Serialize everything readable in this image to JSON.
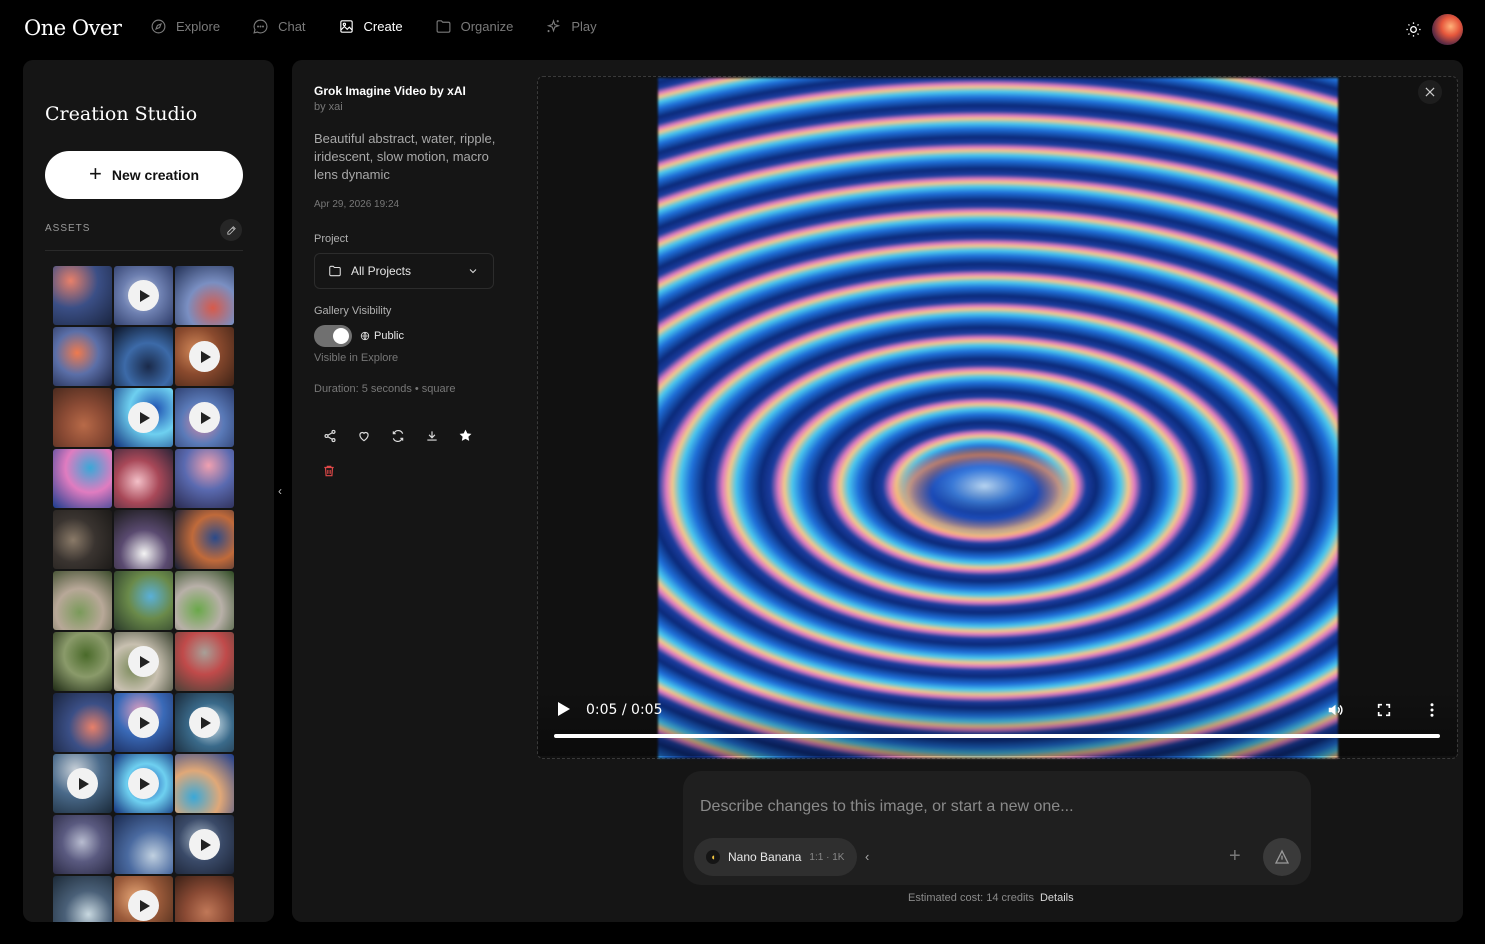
{
  "app": {
    "logo": "One Over"
  },
  "nav": [
    {
      "label": "Explore",
      "icon": "compass-icon",
      "active": false
    },
    {
      "label": "Chat",
      "icon": "chat-bubble-icon",
      "active": false
    },
    {
      "label": "Create",
      "icon": "image-icon",
      "active": true
    },
    {
      "label": "Organize",
      "icon": "folder-icon",
      "active": false
    },
    {
      "label": "Play",
      "icon": "sparkles-icon",
      "active": false
    }
  ],
  "sidebar": {
    "title": "Creation Studio",
    "new_button": "New creation",
    "assets_label": "ASSETS",
    "thumbnails": [
      {
        "video": false,
        "colors": [
          "#e8806a",
          "#3b4f86",
          "#1a2540"
        ]
      },
      {
        "video": true,
        "colors": [
          "#c9d2e8",
          "#6d7fb0",
          "#2d3b68"
        ]
      },
      {
        "video": false,
        "colors": [
          "#d85a4a",
          "#7a8fc2",
          "#223055"
        ]
      },
      {
        "video": false,
        "colors": [
          "#ef7a4e",
          "#5b6fa8",
          "#1c2546"
        ]
      },
      {
        "video": false,
        "colors": [
          "#1a2a4a",
          "#3c6aa8",
          "#0c1426"
        ]
      },
      {
        "video": true,
        "colors": [
          "#d48a5a",
          "#8a4a2e",
          "#3e2216"
        ]
      },
      {
        "video": false,
        "colors": [
          "#b86a48",
          "#8a4a34",
          "#4a2a1e"
        ]
      },
      {
        "video": true,
        "colors": [
          "#1e4fb0",
          "#6ed0f0",
          "#12307a"
        ]
      },
      {
        "video": true,
        "colors": [
          "#d28aa8",
          "#5a7ab8",
          "#2a3a6a"
        ]
      },
      {
        "video": false,
        "colors": [
          "#3aa8d8",
          "#e07cc0",
          "#1a3c8e"
        ]
      },
      {
        "video": false,
        "colors": [
          "#f3c0c8",
          "#a84858",
          "#2a2438"
        ]
      },
      {
        "video": false,
        "colors": [
          "#f0a0b0",
          "#5a6ab0",
          "#2a2a50"
        ]
      },
      {
        "video": false,
        "colors": [
          "#8a7a68",
          "#3a3430",
          "#1c1a18"
        ]
      },
      {
        "video": false,
        "colors": [
          "#f4f4f4",
          "#5a4a70",
          "#1a1a1a"
        ]
      },
      {
        "video": false,
        "colors": [
          "#2a4a8a",
          "#c06a3a",
          "#151e36"
        ]
      },
      {
        "video": false,
        "colors": [
          "#7a9a5a",
          "#b8a898",
          "#3a4a2a"
        ]
      },
      {
        "video": false,
        "colors": [
          "#5ab0d8",
          "#6a8a4a",
          "#2a3a2a"
        ]
      },
      {
        "video": false,
        "colors": [
          "#6aa84a",
          "#b8b0a8",
          "#2e4a22"
        ]
      },
      {
        "video": false,
        "colors": [
          "#4a6a2a",
          "#8a9a6a",
          "#1e2a14"
        ]
      },
      {
        "video": true,
        "colors": [
          "#7a8a5a",
          "#c8c0b0",
          "#3a4230"
        ]
      },
      {
        "video": false,
        "colors": [
          "#a8a098",
          "#c04a4a",
          "#4a4238"
        ]
      },
      {
        "video": false,
        "colors": [
          "#e8806a",
          "#3b4f86",
          "#1a2540"
        ]
      },
      {
        "video": true,
        "colors": [
          "#e0a0c0",
          "#3a6ab8",
          "#1a2a5a"
        ]
      },
      {
        "video": true,
        "colors": [
          "#d8e8f0",
          "#3a6a8a",
          "#1a2a3a"
        ]
      },
      {
        "video": true,
        "colors": [
          "#c8d0d8",
          "#4a6a8a",
          "#1a2a3a"
        ]
      },
      {
        "video": true,
        "colors": [
          "#1e4fb0",
          "#6ed0f0",
          "#12307a"
        ]
      },
      {
        "video": false,
        "colors": [
          "#3aa8d8",
          "#e0a878",
          "#1a3c8e"
        ]
      },
      {
        "video": false,
        "colors": [
          "#b8bcd0",
          "#5a5a80",
          "#2a2a44"
        ]
      },
      {
        "video": false,
        "colors": [
          "#c0d0e0",
          "#4a6aa0",
          "#1a2a50"
        ]
      },
      {
        "video": true,
        "colors": [
          "#a8b8c8",
          "#3a4a68",
          "#1a2234"
        ]
      },
      {
        "video": false,
        "colors": [
          "#c8d8e0",
          "#4a6078",
          "#1c2a38"
        ]
      },
      {
        "video": true,
        "colors": [
          "#e8a878",
          "#9a5a3a",
          "#4a2a1a"
        ]
      },
      {
        "video": false,
        "colors": [
          "#c07858",
          "#8a4a34",
          "#3a2016"
        ]
      }
    ]
  },
  "detail": {
    "title": "Grok Imagine Video by xAI",
    "author": "by xai",
    "prompt": "Beautiful abstract, water, ripple, iridescent, slow motion, macro lens dynamic",
    "date": "Apr 29, 2026 19:24",
    "project_label": "Project",
    "project_value": "All Projects",
    "visibility_label": "Gallery Visibility",
    "visibility_value": "Public",
    "visibility_hint": "Visible in Explore",
    "duration": "Duration: 5 seconds • square",
    "actions": [
      "share-icon",
      "heart-icon",
      "refresh-icon",
      "download-icon",
      "star-icon",
      "trash-icon"
    ]
  },
  "player": {
    "time": "0:05 / 0:05",
    "progress": 1.0
  },
  "composer": {
    "placeholder": "Describe changes to this image, or start a new one...",
    "model": "Nano Banana",
    "model_meta": "1:1 · 1K",
    "cost": "Estimated cost: 14 credits",
    "details": "Details"
  }
}
